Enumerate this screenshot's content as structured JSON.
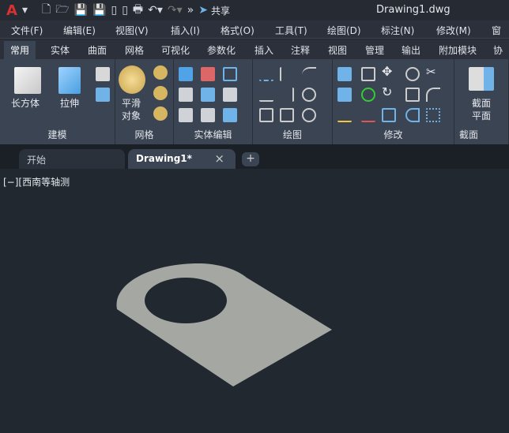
{
  "app": {
    "logo": "A",
    "title": "Drawing1.dwg",
    "share": "共享"
  },
  "quick_access": [
    "new-icon",
    "open-icon",
    "save-icon",
    "save-as-icon",
    "open-web-icon",
    "save-web-icon",
    "print-icon",
    "undo-icon",
    "redo-icon"
  ],
  "menubar": [
    "文件(F)",
    "编辑(E)",
    "视图(V)",
    "插入(I)",
    "格式(O)",
    "工具(T)",
    "绘图(D)",
    "标注(N)",
    "修改(M)",
    "窗口"
  ],
  "ribbon_tabs": [
    "常用",
    "实体",
    "曲面",
    "网格",
    "可视化",
    "参数化",
    "插入",
    "注释",
    "视图",
    "管理",
    "输出",
    "附加模块",
    "协作"
  ],
  "active_ribbon_tab": "常用",
  "panels": {
    "modeling": {
      "label": "建模",
      "box": "长方体",
      "extrude": "拉伸"
    },
    "mesh": {
      "label": "网格",
      "smooth": "平滑",
      "smooth2": "对象"
    },
    "solid_edit": {
      "label": "实体编辑"
    },
    "draw": {
      "label": "绘图"
    },
    "modify": {
      "label": "修改"
    },
    "section": {
      "label": "截面",
      "plane": "截面",
      "plane2": "平面"
    }
  },
  "doc_tabs": {
    "start": "开始",
    "drawing": "Drawing1*",
    "close": "×",
    "add": "+"
  },
  "viewport": {
    "label": "[−][西南等轴测"
  },
  "colors": {
    "accent": "#d9312f",
    "canvas": "#212830",
    "shape": "#a5a8a2"
  }
}
